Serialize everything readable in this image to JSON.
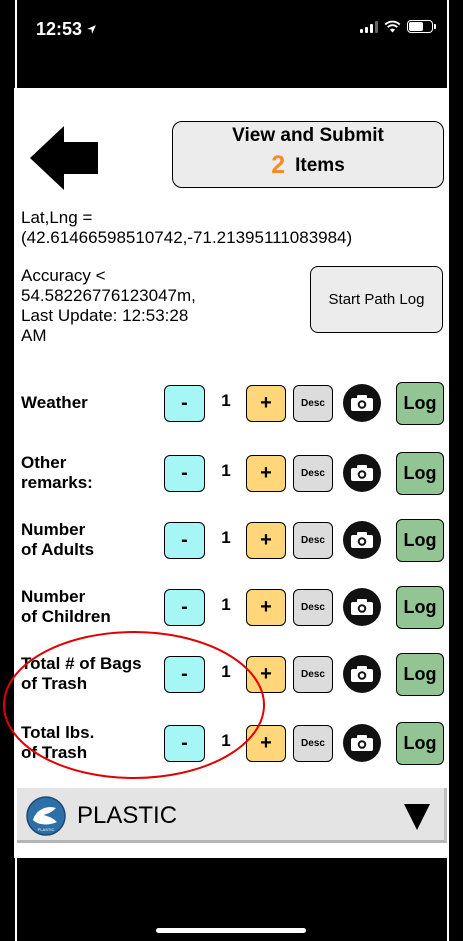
{
  "status_bar": {
    "time": "12:53",
    "location_icon": "location-arrow-icon",
    "signal_icon": "cellular-signal-icon",
    "wifi_icon": "wifi-icon",
    "battery_icon": "battery-icon"
  },
  "header": {
    "back_icon": "back-arrow-icon",
    "submit_title": "View and Submit",
    "submit_count": "2",
    "submit_suffix": "Items"
  },
  "location": {
    "latlng_label": "Lat,Lng =",
    "latlng_value": "(42.61466598510742,-71.21395111083984)",
    "accuracy_line1": "Accuracy <",
    "accuracy_line2": "54.58226776123047m,",
    "accuracy_line3": "Last Update: 12:53:28",
    "accuracy_line4": "AM",
    "path_log_label": "Start Path Log"
  },
  "rows": [
    {
      "label_line1": "Weather",
      "label_line2": "",
      "qty": "1",
      "minus": "-",
      "plus": "+",
      "desc": "Desc",
      "log": "Log"
    },
    {
      "label_line1": "Other",
      "label_line2": "remarks:",
      "qty": "1",
      "minus": "-",
      "plus": "+",
      "desc": "Desc",
      "log": "Log"
    },
    {
      "label_line1": "Number",
      "label_line2": "of Adults",
      "qty": "1",
      "minus": "-",
      "plus": "+",
      "desc": "Desc",
      "log": "Log"
    },
    {
      "label_line1": "Number",
      "label_line2": "of Children",
      "qty": "1",
      "minus": "-",
      "plus": "+",
      "desc": "Desc",
      "log": "Log"
    },
    {
      "label_line1": "Total # of Bags",
      "label_line2": "of Trash",
      "qty": "1",
      "minus": "-",
      "plus": "+",
      "desc": "Desc",
      "log": "Log"
    },
    {
      "label_line1": "Total lbs.",
      "label_line2": "of Trash",
      "qty": "1",
      "minus": "-",
      "plus": "+",
      "desc": "Desc",
      "log": "Log"
    }
  ],
  "material": {
    "label": "PLASTIC",
    "logo_text": "PLASTIC",
    "arrow_icon": "dropdown-triangle-icon"
  },
  "colors": {
    "minus": "#a6f6f6",
    "plus": "#ffd77a",
    "log": "#93c493",
    "count": "#f28c28",
    "annotation": "#e00000"
  }
}
